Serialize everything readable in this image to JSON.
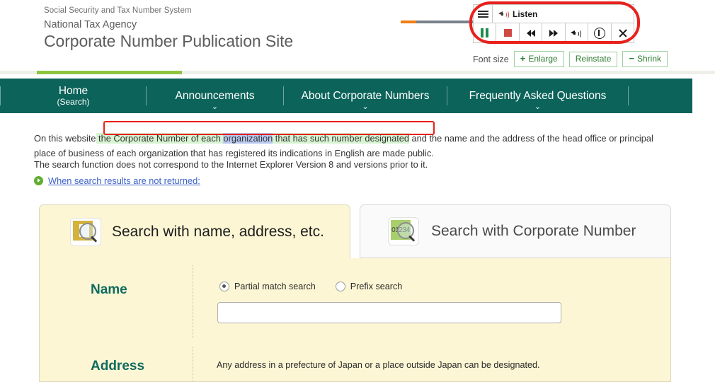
{
  "header": {
    "tagline": "Social Security and Tax Number System",
    "agency": "National Tax Agency",
    "site_name": "Corporate Number Publication Site"
  },
  "tts_toolbar": {
    "menu_icon": "hamburger-menu-icon",
    "listen_label": "Listen",
    "listen_icon": "speaker-icon",
    "controls": [
      {
        "name": "pause-button",
        "icon": "pause-icon",
        "color": "#1f8a4c"
      },
      {
        "name": "stop-button",
        "icon": "stop-square-icon",
        "color": "#cf4a43"
      },
      {
        "name": "rewind-button",
        "icon": "rewind-icon",
        "color": "#1a1a1a"
      },
      {
        "name": "fast-forward-button",
        "icon": "fast-forward-icon",
        "color": "#1a1a1a"
      },
      {
        "name": "volume-button",
        "icon": "volume-icon",
        "color": "#1a1a1a"
      },
      {
        "name": "info-button",
        "icon": "info-circle-icon",
        "color": "#1a1a1a"
      },
      {
        "name": "close-button",
        "icon": "close-x-icon",
        "color": "#1a1a1a"
      }
    ],
    "seekbar": {
      "track_color": "#78828c",
      "progress_color": "#f07d12",
      "progress_percent": 18
    },
    "annotation_color": "#e8211c"
  },
  "font_size": {
    "label": "Font size",
    "enlarge_sign": "+",
    "enlarge_label": "Enlarge",
    "reinstate_label": "Reinstate",
    "shrink_sign": "−",
    "shrink_label": "Shrink",
    "accent_color": "#2e7d32"
  },
  "nav": {
    "background": "#0b635a",
    "active_indicator_color": "#8ec540",
    "items": [
      {
        "label": "Home",
        "sub": "(Search)",
        "has_caret": false,
        "active": true
      },
      {
        "label": "Announcements",
        "sub": "",
        "has_caret": true,
        "active": false
      },
      {
        "label": "About Corporate Numbers",
        "sub": "",
        "has_caret": true,
        "active": false
      },
      {
        "label": "Frequently Asked Questions",
        "sub": "",
        "has_caret": true,
        "active": false
      }
    ],
    "caret_glyph": "⌄"
  },
  "intro": {
    "lead": "On this website",
    "highlight_before": " the Corporate Number of each ",
    "highlight_word": "organization",
    "highlight_after": " that has such number designated",
    "rest": " and the name and the address of the head office or principal place of business of each organization that has registered its indications in English are made public.",
    "read_highlight_color": "#d8f3d2",
    "word_highlight_color": "#b9c9f2",
    "annotation_color": "#e8211c"
  },
  "notes": {
    "ie_note": "The search function does not correspond to the Internet Explorer Version 8 and versions prior to it.",
    "link_bullet_icon": "arrow-circle-right-icon",
    "link_text": "When search results are not returned:",
    "link_color": "#3c62c8"
  },
  "tabs": [
    {
      "label": "Search with name, address, etc.",
      "icon": "building-search-icon",
      "active": true,
      "background": "#fcf6d4"
    },
    {
      "label": "Search with Corporate Number",
      "icon": "number-search-icon",
      "icon_text": "01234",
      "active": false,
      "background": "#fafafa"
    }
  ],
  "search_form": {
    "background": "#fcf6d4",
    "label_color": "#0f6b5e",
    "name": {
      "label": "Name",
      "options": [
        {
          "label": "Partial match search",
          "checked": true
        },
        {
          "label": "Prefix search",
          "checked": false
        }
      ],
      "input_value": "",
      "input_placeholder": ""
    },
    "address": {
      "label": "Address",
      "hint": "Any address in a prefecture of Japan or a place outside Japan can be designated."
    }
  }
}
